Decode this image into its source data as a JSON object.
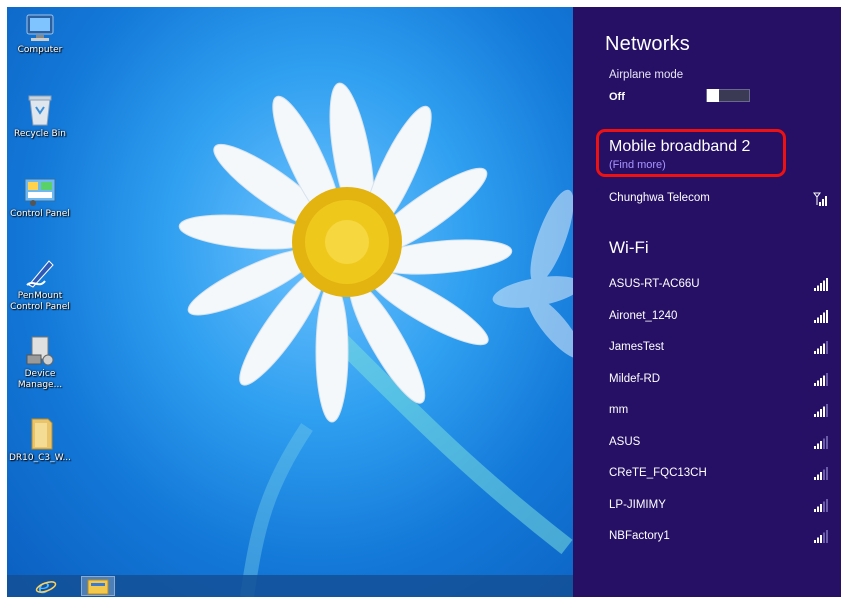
{
  "desktop": {
    "icons": [
      {
        "label": "Computer"
      },
      {
        "label": "Recycle Bin"
      },
      {
        "label": "Control Panel"
      },
      {
        "label": "PenMount Control Panel"
      },
      {
        "label": "Device Manage..."
      },
      {
        "label": "DR10_C3_W..."
      }
    ]
  },
  "panel": {
    "title": "Networks",
    "airplane_label": "Airplane mode",
    "airplane_state": "Off",
    "mobile_section_title": "Mobile broadband 2",
    "mobile_link": "(Find more)",
    "mobile_networks": [
      {
        "name": "Chunghwa Telecom",
        "signal": 5,
        "icon": "cellular-signal-icon"
      }
    ],
    "wifi_title": "Wi-Fi",
    "wifi_networks": [
      {
        "name": "ASUS-RT-AC66U",
        "signal": 5
      },
      {
        "name": "Aironet_1240",
        "signal": 5
      },
      {
        "name": "JamesTest",
        "signal": 4
      },
      {
        "name": "Mildef-RD",
        "signal": 4
      },
      {
        "name": "mm",
        "signal": 4
      },
      {
        "name": "ASUS",
        "signal": 3
      },
      {
        "name": "CReTE_FQC13CH",
        "signal": 3
      },
      {
        "name": "LP-JIMIMY",
        "signal": 3
      },
      {
        "name": "NBFactory1",
        "signal": 3
      }
    ]
  },
  "colors": {
    "panel_bg": "#261066",
    "highlight": "#ee1111",
    "link": "#a895ff"
  }
}
